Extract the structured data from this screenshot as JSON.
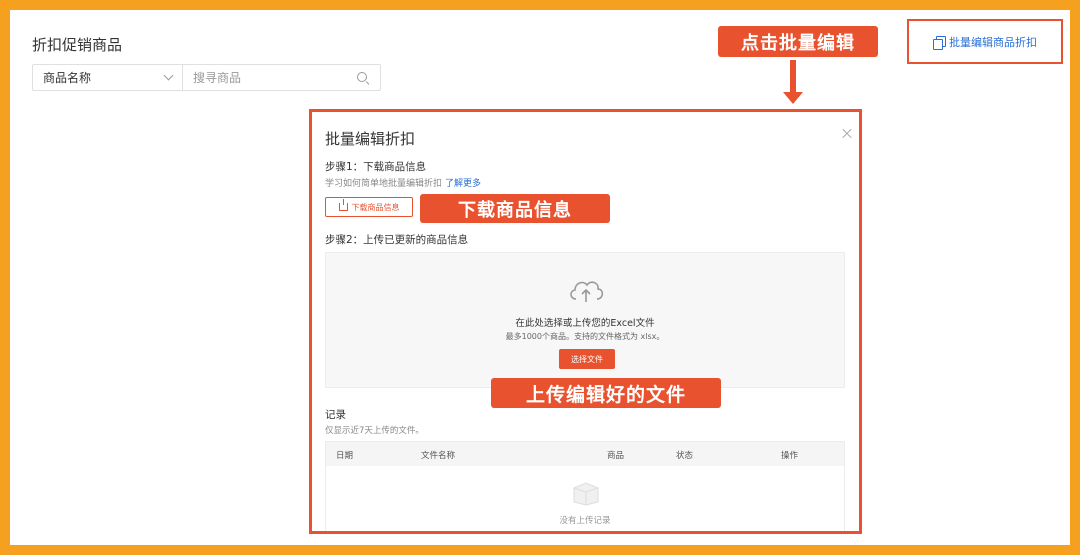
{
  "page": {
    "title": "折扣促销商品",
    "filter": {
      "select_value": "商品名称",
      "search_placeholder": "搜寻商品"
    },
    "batch_edit_link": "批量编辑商品折扣"
  },
  "callouts": {
    "click_batch": "点击批量编辑",
    "download": "下载商品信息",
    "upload": "上传编辑好的文件"
  },
  "modal": {
    "title": "批量编辑折扣",
    "step1_title": "步骤1：下载商品信息",
    "step1_hint": "学习如何简单地批量编辑折扣",
    "step1_link": "了解更多",
    "download_button": "下载商品信息",
    "step2_title": "步骤2：上传已更新的商品信息",
    "upload_main": "在此处选择或上传您的Excel文件",
    "upload_sub": "最多1000个商品。支持的文件格式为 xlsx。",
    "choose_button": "选择文件",
    "records_title": "记录",
    "records_hint": "仅显示近7天上传的文件。",
    "table_columns": [
      "日期",
      "文件名称",
      "商品",
      "状态",
      "操作"
    ],
    "empty_text": "没有上传记录"
  },
  "colors": {
    "frame_orange": "#f5a01e",
    "accent_red": "#e8522f",
    "link_blue": "#2a6fd6"
  }
}
